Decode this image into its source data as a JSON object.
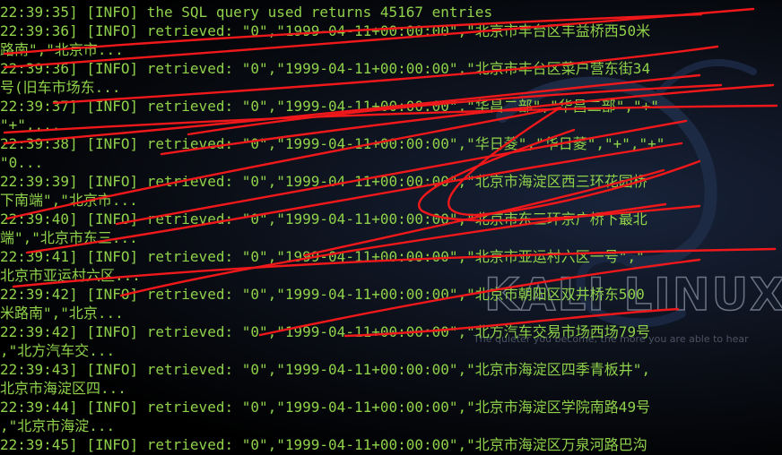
{
  "watermark": {
    "logo": "KALI LINUX",
    "tagline": "The quieter you become, the more you are able to hear",
    "dragon_icon": "kali-dragon-icon"
  },
  "log": {
    "lines": [
      "22:39:35] [INFO] the SQL query used returns 45167 entries",
      "22:39:36] [INFO] retrieved: \"0\",\"1999-04-11+00:00:00\",\"北京市丰台区丰益桥西50米",
      "路南\",\"北京市...",
      "22:39:36] [INFO] retrieved: \"0\",\"1999-04-11+00:00:00\",\"北京市丰台区菜户营东街34",
      "号(旧车市场东...",
      "22:39:37] [INFO] retrieved: \"0\",\"1999-04-11+00:00:00\",\"华昌二部\",\"华昌二部\",\"+\"",
      "\"+\",...",
      "22:39:38] [INFO] retrieved: \"0\",\"1999-04-11+00:00:00\",\"华日菱\",\"华日菱\",\"+\",\"+\"",
      "\"0...",
      "22:39:39] [INFO] retrieved: \"0\",\"1999-04-11+00:00:00\",\"北京市海淀区西三环花园桥",
      "下南端\",\"北京市...",
      "22:39:40] [INFO] retrieved: \"0\",\"1999-04-11+00:00:00\",\"北京市东三环京广桥下最北",
      "端\",\"北京市东三...",
      "22:39:41] [INFO] retrieved: \"0\",\"1999-04-11+00:00:00\",\"北京市亚运村六区一号\",\"",
      "北京市亚运村六区...",
      "22:39:42] [INFO] retrieved: \"0\",\"1999-04-11+00:00:00\",\"北京市朝阳区双井桥东500",
      "米路南\",\"北京...",
      "22:39:42] [INFO] retrieved: \"0\",\"1999-04-11+00:00:00\",\"北方汽车交易市场西场79号",
      ",\"北方汽车交...",
      "22:39:43] [INFO] retrieved: \"0\",\"1999-04-11+00:00:00\",\"北京市海淀区四季青板井\",",
      "北京市海淀区四...",
      "22:39:44] [INFO] retrieved: \"0\",\"1999-04-11+00:00:00\",\"北京市海淀区学院南路49号",
      ",\"北京市海淀...",
      "22:39:45] [INFO] retrieved: \"0\",\"1999-04-11+00:00:00\",\"北京市海淀区万泉河路巴沟"
    ]
  },
  "colors": {
    "background": "#000000",
    "text": "#8fd24a",
    "scribble": "#f0181a",
    "watermark": "#6c7484"
  }
}
